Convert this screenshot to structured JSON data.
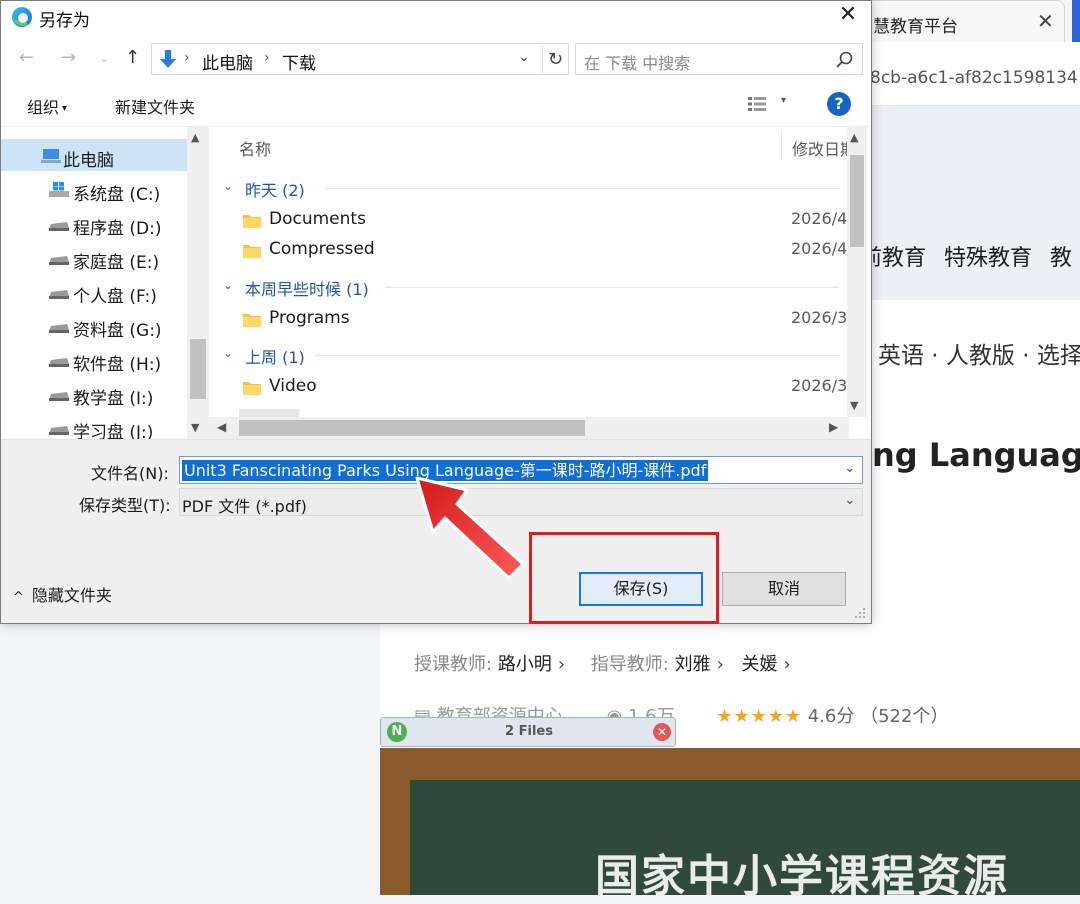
{
  "background_page": {
    "tab_title": "慧教育平台",
    "url_fragment": "8cb-a6c1-af82c1598134",
    "nav_items": [
      "前教育",
      "特殊教育",
      "教"
    ],
    "breadcrumb": "英语 · 人教版 · 选择",
    "lesson_title": "ng Language",
    "teacher_label": "授课教师:",
    "teacher_name": "路小明",
    "advisor_label": "指导教师:",
    "advisor_1": "刘雅",
    "advisor_2": "关媛",
    "source": "教育部资源中心",
    "views": "1.6万",
    "rating": "4.6分",
    "rating_count": "（522个）",
    "board_text": "国家中小学课程资源"
  },
  "files_pill": {
    "label": "2 Files"
  },
  "dialog": {
    "title": "另存为",
    "address": {
      "crumbs": [
        "此电脑",
        "下载"
      ]
    },
    "search_placeholder": "在 下载 中搜索",
    "toolbar": {
      "organize": "组织",
      "new_folder": "新建文件夹"
    },
    "sidebar": {
      "items": [
        {
          "label": "此电脑"
        },
        {
          "label": "系统盘 (C:)"
        },
        {
          "label": "程序盘 (D:)"
        },
        {
          "label": "家庭盘 (E:)"
        },
        {
          "label": "个人盘 (F:)"
        },
        {
          "label": "资料盘 (G:)"
        },
        {
          "label": "软件盘 (H:)"
        },
        {
          "label": "教学盘 (I:)"
        },
        {
          "label": "学习盘 (J:)"
        }
      ]
    },
    "columns": {
      "name": "名称",
      "date": "修改日期"
    },
    "groups": [
      {
        "label": "昨天 (2)",
        "files": [
          {
            "name": "Documents",
            "date": "2026/4"
          },
          {
            "name": "Compressed",
            "date": "2026/4"
          }
        ]
      },
      {
        "label": "本周早些时候 (1)",
        "files": [
          {
            "name": "Programs",
            "date": "2026/3"
          }
        ]
      },
      {
        "label": "上周 (1)",
        "files": [
          {
            "name": "Video",
            "date": "2026/3"
          }
        ]
      }
    ],
    "form": {
      "filename_label": "文件名(N):",
      "filename_value": "Unit3 Fanscinating Parks Using Language-第一课时-路小明-课件.pdf",
      "filetype_label": "保存类型(T):",
      "filetype_value": "PDF 文件 (*.pdf)"
    },
    "hide_folders": "隐藏文件夹",
    "save_button": "保存(S)",
    "cancel_button": "取消"
  },
  "colors": {
    "accent": "#1a73e8",
    "selection": "#0f6fd6",
    "annotation_red": "#e01e1e"
  }
}
